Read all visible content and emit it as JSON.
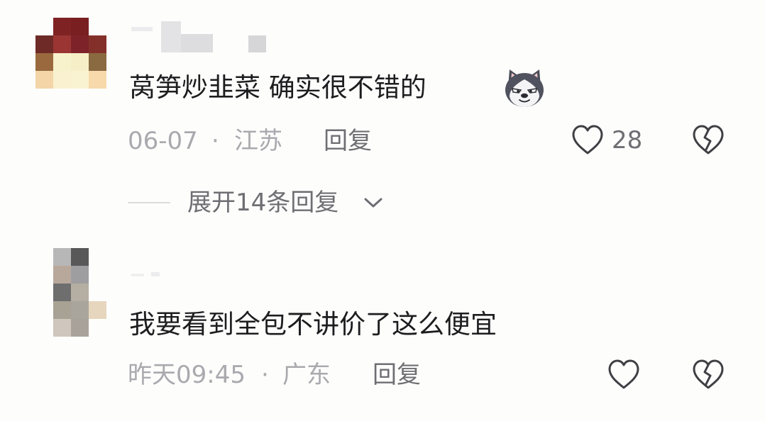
{
  "comments": [
    {
      "text": "莴笋炒韭菜  确实很不错的",
      "emoji_icon": "husky-dog-emoji-icon",
      "date": "06-07",
      "separator": "·",
      "location": "江苏",
      "reply_label": "回复",
      "like_count": "28",
      "expand_label": "展开14条回复"
    },
    {
      "text": "我要看到全包不讲价了这么便宜",
      "date": "昨天09:45",
      "separator": "·",
      "location": "广东",
      "reply_label": "回复"
    }
  ],
  "colors": {
    "background": "#fdfdfc",
    "text_main": "#1d1d1f",
    "text_meta": "#a9a9ae",
    "text_secondary": "#6e6e73",
    "icon_stroke": "#3f3f44"
  }
}
